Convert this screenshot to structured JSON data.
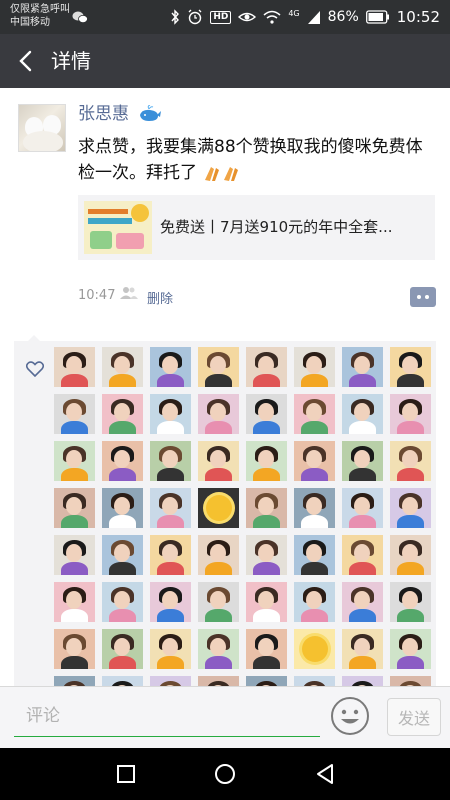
{
  "status_bar": {
    "carrier_line1": "仅限紧急呼叫",
    "carrier_line2": "中国移动",
    "hd_badge": "HD",
    "network": "4G",
    "battery": "86%",
    "time": "10:52"
  },
  "header": {
    "title": "详情",
    "back_icon": "chevron-left-icon"
  },
  "post": {
    "username": "张思惠",
    "username_emoji": "whale-icon",
    "text": "求点赞，我要集满88个赞换取我的傻咪免费体检一次。拜托了",
    "text_emoji": "clapping-hands-icon",
    "link_card": {
      "title": "免费送丨7月送910元的年中全套..."
    },
    "time": "10:47",
    "delete_label": "删除",
    "likes_icon": "heart-icon"
  },
  "comment_bar": {
    "placeholder": "评论",
    "send_label": "发送",
    "emoji_icon": "smiley-face-icon"
  },
  "nav_bar": {
    "icons": [
      "square-recents-icon",
      "circle-home-icon",
      "triangle-back-icon"
    ]
  },
  "colors": {
    "link_blue": "#576b95",
    "title_bar": "#393a3f",
    "accent_green": "#26ab3f"
  }
}
